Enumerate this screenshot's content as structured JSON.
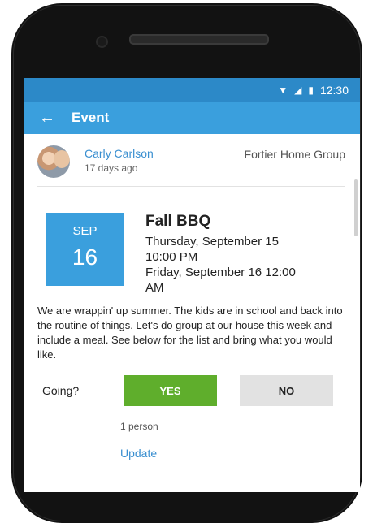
{
  "status_bar": {
    "time": "12:30"
  },
  "app_bar": {
    "title": "Event",
    "back_icon": "←"
  },
  "poster": {
    "name": "Carly Carlson",
    "time_ago": "17 days ago",
    "group": "Fortier Home Group"
  },
  "event": {
    "month": "SEP",
    "day": "16",
    "title": "Fall BBQ",
    "start_date": "Thursday, September 15",
    "start_time": "10:00 PM",
    "end_date": "Friday, September 16  12:00",
    "end_time": "AM",
    "description": "We are wrappin' up summer. The kids are in school and back into the routine of things. Let's do group at our house this week and include a meal. See below for the list and bring what you would like."
  },
  "rsvp": {
    "label": "Going?",
    "yes_label": "YES",
    "no_label": "NO",
    "count": "1 person",
    "update_label": "Update"
  },
  "colors": {
    "accent": "#3a9fdd",
    "yes": "#5fae2c",
    "link": "#3a8fd0"
  }
}
